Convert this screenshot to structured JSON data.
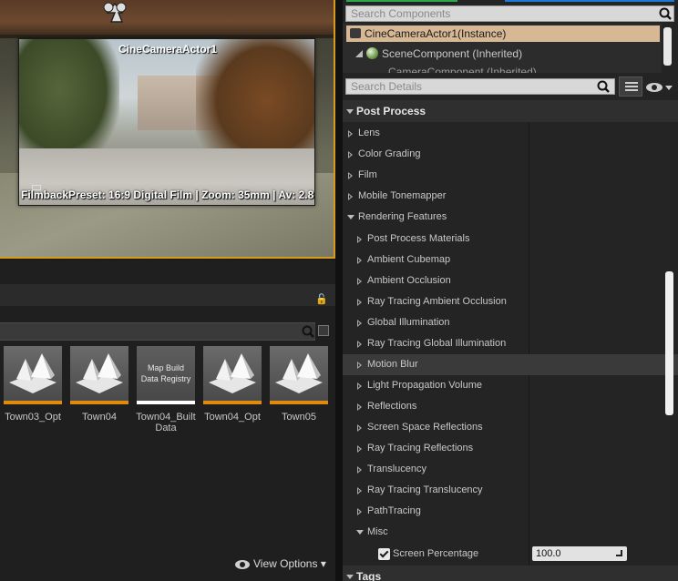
{
  "viewport": {
    "camera_title": "CineCameraActor1",
    "camera_info": "FilmbackPreset: 16:9 Digital Film | Zoom: 35mm | Av: 2.8"
  },
  "content_browser": {
    "assets": [
      {
        "label": "Town03_Opt",
        "kind": "level"
      },
      {
        "label": "Town04",
        "kind": "level"
      },
      {
        "label": "Town04_Built\nData",
        "kind": "registry",
        "thumb_text": "Map Build\nData Registry"
      },
      {
        "label": "Town04_Opt",
        "kind": "level"
      },
      {
        "label": "Town05",
        "kind": "level"
      }
    ],
    "view_options_label": "View Options",
    "accent_level": "#e08b0b"
  },
  "components": {
    "search_placeholder": "Search Components",
    "selected": "CineCameraActor1(Instance)",
    "scene": "SceneComponent (Inherited)",
    "cut_off": "CameraComponent (Inherited)"
  },
  "details": {
    "search_placeholder": "Search Details",
    "rows": [
      {
        "label": "Post Process",
        "type": "category"
      },
      {
        "label": "Lens",
        "type": "collapsed",
        "indent": 0
      },
      {
        "label": "Color Grading",
        "type": "collapsed",
        "indent": 0
      },
      {
        "label": "Film",
        "type": "collapsed",
        "indent": 0
      },
      {
        "label": "Mobile Tonemapper",
        "type": "collapsed",
        "indent": 0
      },
      {
        "label": "Rendering Features",
        "type": "expanded",
        "indent": 0
      },
      {
        "label": "Post Process Materials",
        "type": "collapsed",
        "indent": 1
      },
      {
        "label": "Ambient Cubemap",
        "type": "collapsed",
        "indent": 1
      },
      {
        "label": "Ambient Occlusion",
        "type": "collapsed",
        "indent": 1
      },
      {
        "label": "Ray Tracing Ambient Occlusion",
        "type": "collapsed",
        "indent": 1
      },
      {
        "label": "Global Illumination",
        "type": "collapsed",
        "indent": 1
      },
      {
        "label": "Ray Tracing Global Illumination",
        "type": "collapsed",
        "indent": 1
      },
      {
        "label": "Motion Blur",
        "type": "collapsed",
        "indent": 1,
        "highlight": true
      },
      {
        "label": "Light Propagation Volume",
        "type": "collapsed",
        "indent": 1
      },
      {
        "label": "Reflections",
        "type": "collapsed",
        "indent": 1
      },
      {
        "label": "Screen Space Reflections",
        "type": "collapsed",
        "indent": 1
      },
      {
        "label": "Ray Tracing Reflections",
        "type": "collapsed",
        "indent": 1
      },
      {
        "label": "Translucency",
        "type": "collapsed",
        "indent": 1
      },
      {
        "label": "Ray Tracing Translucency",
        "type": "collapsed",
        "indent": 1
      },
      {
        "label": "PathTracing",
        "type": "collapsed",
        "indent": 1
      },
      {
        "label": "Misc",
        "type": "expanded",
        "indent": 1
      },
      {
        "label": "Screen Percentage",
        "type": "property",
        "checked": true,
        "value": "100.0"
      },
      {
        "label": "Tags",
        "type": "category"
      }
    ]
  },
  "colors": {
    "selection": "#d7b894",
    "tab_green": "#2ea64a",
    "tab_blue": "#1e78d6",
    "viewport_border": "#d79a1a"
  }
}
